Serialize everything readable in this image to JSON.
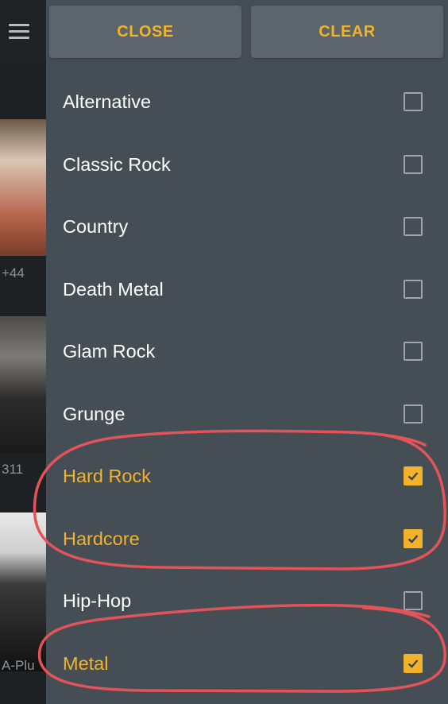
{
  "background_app": {
    "captions": [
      "+44",
      "311",
      "A-Plu"
    ]
  },
  "filter_panel": {
    "close_label": "CLOSE",
    "clear_label": "CLEAR",
    "genres": [
      {
        "label": "Alternative",
        "checked": false
      },
      {
        "label": "Classic Rock",
        "checked": false
      },
      {
        "label": "Country",
        "checked": false
      },
      {
        "label": "Death Metal",
        "checked": false
      },
      {
        "label": "Glam Rock",
        "checked": false
      },
      {
        "label": "Grunge",
        "checked": false
      },
      {
        "label": "Hard Rock",
        "checked": true
      },
      {
        "label": "Hardcore",
        "checked": true
      },
      {
        "label": "Hip-Hop",
        "checked": false
      },
      {
        "label": "Metal",
        "checked": true
      }
    ]
  },
  "colors": {
    "accent": "#f2b32a",
    "panel": "#464e55",
    "button": "#5d656c",
    "annotation": "#e5535a"
  },
  "icons": [
    "menu-icon",
    "checkbox-icon",
    "checkmark-icon"
  ]
}
